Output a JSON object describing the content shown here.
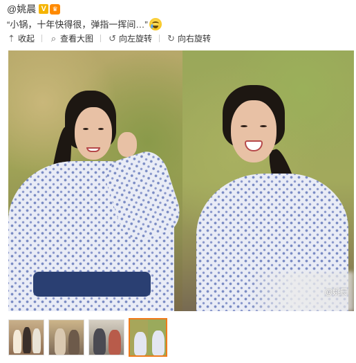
{
  "post": {
    "author": "@姚晨",
    "verified_badge": "V",
    "text": "“小锅，十年快得很，弹指一挥间…”",
    "emoji": "crying-face"
  },
  "toolbar": {
    "collapse_label": "收起",
    "view_large_label": "查看大图",
    "rotate_left_label": "向左旋转",
    "rotate_right_label": "向右旋转"
  },
  "image": {
    "watermark": "@姚晨"
  },
  "thumbnails": {
    "count": 4,
    "selected_index": 3
  },
  "colors": {
    "selected_thumb_border": "#f07a1a",
    "verified_badge": "#f5b400"
  }
}
